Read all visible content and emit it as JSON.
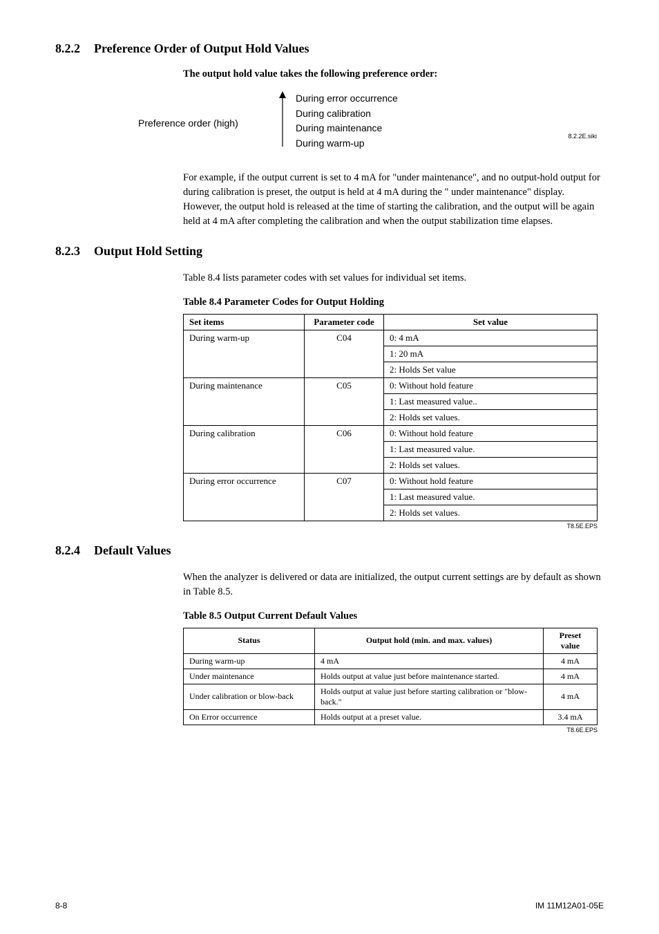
{
  "sections": {
    "s822": {
      "num": "8.2.2",
      "title": "Preference Order of Output Hold Values"
    },
    "s823": {
      "num": "8.2.3",
      "title": "Output Hold Setting"
    },
    "s824": {
      "num": "8.2.4",
      "title": "Default Values"
    }
  },
  "s822": {
    "subheading": "The output hold value takes the following preference order:",
    "pref_label": "Preference order (high)",
    "pref_items": [
      "During error occurrence",
      "During calibration",
      "During maintenance",
      "During warm-up"
    ],
    "siki": "8.2.2E.siki",
    "para": "For example, if the output current is set to 4 mA for \"under maintenance\", and no output-hold output for during calibration is preset, the output is held at 4 mA during the \" under maintenance\" display. However, the output hold is released at the time of starting the calibration, and the output will be again held at 4 mA after completing the calibration and when the output stabilization time elapses."
  },
  "s823": {
    "intro": "Table 8.4 lists parameter codes with set values for individual set items.",
    "table_caption": "Table 8.4   Parameter Codes for Output Holding",
    "headers": {
      "col1": "Set items",
      "col2": "Parameter code",
      "col3": "Set value"
    },
    "rows": [
      {
        "item": "During warm-up",
        "code": "C04",
        "values": [
          "0:  4 mA",
          "1:  20 mA",
          "2:  Holds Set value"
        ]
      },
      {
        "item": "During maintenance",
        "code": "C05",
        "values": [
          "0:  Without hold feature",
          "1:  Last measured value..",
          "2:  Holds set values."
        ]
      },
      {
        "item": "During calibration",
        "code": "C06",
        "values": [
          "0:  Without hold feature",
          "1:  Last measured value.",
          "2:  Holds set values."
        ]
      },
      {
        "item": "During error occurrence",
        "code": "C07",
        "values": [
          "0:  Without hold feature",
          "1:  Last measured value.",
          "2:  Holds set values."
        ]
      }
    ],
    "eps": "T8.5E.EPS"
  },
  "s824": {
    "intro": "When the analyzer is delivered or data are initialized, the output current settings are by default as shown in Table 8.5.",
    "table_caption": "Table 8.5   Output Current Default Values",
    "headers": {
      "col1": "Status",
      "col2": "Output hold (min. and max. values)",
      "col3": "Preset value"
    },
    "rows": [
      {
        "status": "During warm-up",
        "hold": "4 mA",
        "preset": "4 mA"
      },
      {
        "status": "Under maintenance",
        "hold": "Holds output at value just before maintenance started.",
        "preset": "4 mA"
      },
      {
        "status": "Under calibration or blow-back",
        "hold": "Holds output at value just before starting calibration or \"blow-back.\"",
        "preset": "4 mA"
      },
      {
        "status": "On Error occurrence",
        "hold": "Holds output at a preset value.",
        "preset": "3.4 mA"
      }
    ],
    "eps": "T8.6E.EPS"
  },
  "footer": {
    "left": "8-8",
    "right": "IM 11M12A01-05E"
  }
}
